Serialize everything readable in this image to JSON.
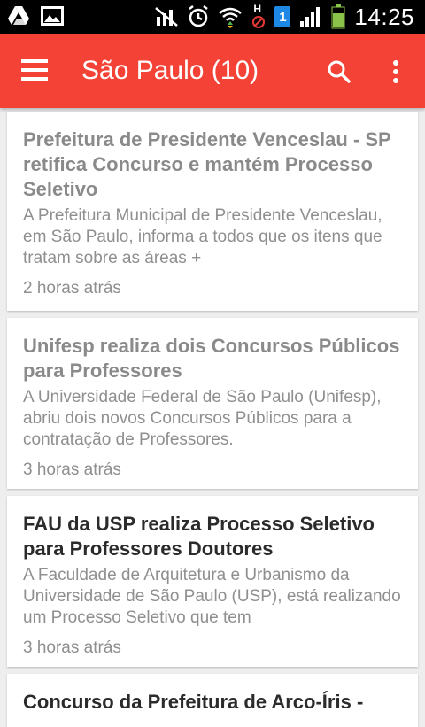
{
  "status_bar": {
    "time": "14:25",
    "sim_badge": "1",
    "data_indicator": "H",
    "icons": [
      "drive-icon",
      "image-icon",
      "mute-icon",
      "alarm-icon",
      "wifi-icon",
      "no-data-icon",
      "sim-icon",
      "signal-icon",
      "battery-icon"
    ],
    "battery_color": "#8bc34a"
  },
  "app_bar": {
    "title": "São Paulo (10)",
    "color": "#f44336",
    "menu_icon": "menu-icon",
    "search_icon": "search-icon",
    "overflow_icon": "more-vert-icon"
  },
  "articles": [
    {
      "title": "Prefeitura de Presidente Venceslau - SP retifica Concurso e mantém Processo Seletivo",
      "summary": "A Prefeitura Municipal de Presidente Venceslau, em São Paulo, informa a todos que os itens que tratam sobre as áreas +",
      "time": "2 horas atrás",
      "read": true
    },
    {
      "title": "Unifesp realiza dois Concursos Públicos para Professores",
      "summary": "A Universidade Federal de São Paulo (Unifesp), abriu dois novos Concursos Públicos para a contratação de Professores.",
      "time": "3 horas atrás",
      "read": true
    },
    {
      "title": "FAU da USP realiza Processo Seletivo para Professores Doutores",
      "summary": "A Faculdade de Arquitetura e Urbanismo da Universidade de São Paulo (USP), está realizando um Processo Seletivo que tem",
      "time": "3 horas atrás",
      "read": false
    },
    {
      "title": "Concurso da Prefeitura de Arco-Íris -",
      "summary": "",
      "time": "",
      "read": false
    }
  ]
}
